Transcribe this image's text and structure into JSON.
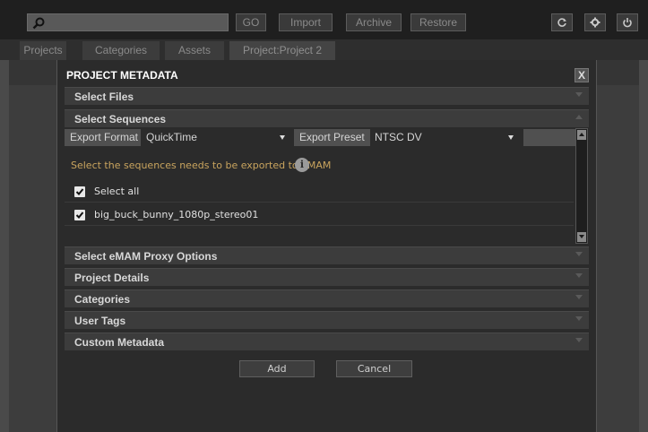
{
  "toolbar": {
    "search": {
      "value": "",
      "icon": "search-icon"
    },
    "go_label": "GO",
    "import_label": "Import",
    "archive_label": "Archive",
    "restore_label": "Restore",
    "icons": [
      "refresh-icon",
      "gear-icon",
      "power-icon"
    ]
  },
  "tabs": [
    {
      "label": "Projects"
    },
    {
      "label": "Categories"
    },
    {
      "label": "Assets"
    },
    {
      "label": "Project:Project 2",
      "active": true
    }
  ],
  "modal": {
    "title": "PROJECT METADATA",
    "close_label": "X",
    "sections": [
      {
        "label": "Select Files",
        "expanded": false
      },
      {
        "label": "Select Sequences",
        "expanded": true
      },
      {
        "label": "Select eMAM Proxy Options",
        "expanded": false
      },
      {
        "label": "Project Details",
        "expanded": false
      },
      {
        "label": "Categories",
        "expanded": false
      },
      {
        "label": "User Tags",
        "expanded": false
      },
      {
        "label": "Custom Metadata",
        "expanded": false
      }
    ],
    "export": {
      "format_label": "Export Format",
      "format_value": "QuickTime",
      "preset_label": "Export Preset",
      "preset_value": "NTSC DV"
    },
    "sequences": {
      "hint": "Select the sequences needs to be exported to eMAM",
      "select_all": {
        "label": "Select all",
        "checked": true
      },
      "items": [
        {
          "label": "big_buck_bunny_1080p_stereo01",
          "checked": true
        }
      ]
    },
    "buttons": {
      "add": "Add",
      "cancel": "Cancel"
    }
  },
  "colors": {
    "toolbar_bg": "#1f1f1f",
    "modal_bg": "#2b2b2b",
    "section_bg": "#3c3c3c",
    "hint_text": "#c9a45e"
  }
}
